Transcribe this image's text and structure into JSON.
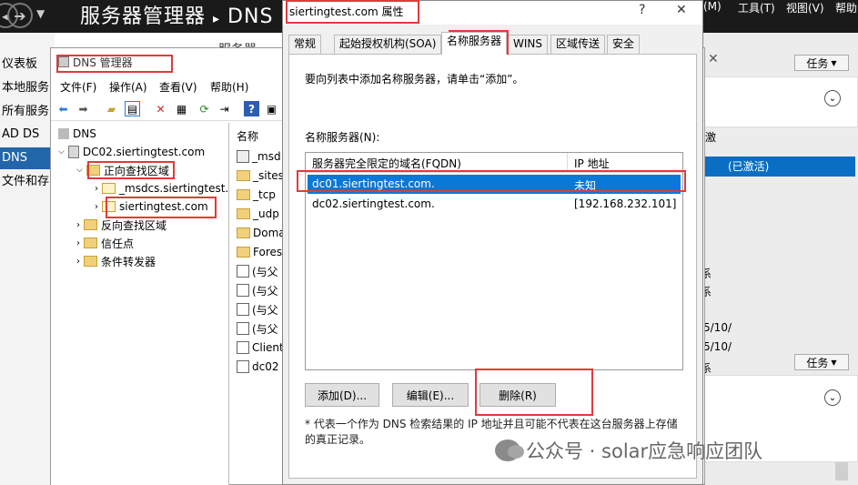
{
  "server_manager": {
    "title": "服务器管理器",
    "title_sep": "▸",
    "title_crumb": "DNS",
    "menus": [
      "(M)",
      "工具(T)",
      "视图(V)",
      "帮助"
    ],
    "sidebar": [
      "仪表板",
      "本地服务",
      "所有服务",
      "AD DS",
      "DNS",
      "文件和存"
    ],
    "sidebar_active_index": 4,
    "servers_label": "服务器",
    "tasks_label": "任务",
    "col_label": "激",
    "highlight_text": "(已激活)",
    "right_fragments": [
      "系",
      "系",
      "5/10/",
      "5/10/",
      "系"
    ]
  },
  "dns_manager": {
    "title": "DNS 管理器",
    "menu": [
      "文件(F)",
      "操作(A)",
      "查看(V)",
      "帮助(H)"
    ],
    "tree": {
      "root": "DNS",
      "server": "DC02.siertingtest.com",
      "forward_zones": "正向查找区域",
      "msdcs_zone": "_msdcs.siertingtest.",
      "zone": "siertingtest.com",
      "reverse_zones": "反向查找区域",
      "trust_points": "信任点",
      "forwarders": "条件转发器"
    },
    "list_header": "名称",
    "list_items": [
      "_msd",
      "_sites",
      "_tcp",
      "_udp",
      "Doma",
      "Fores",
      "(与父",
      "(与父",
      "(与父",
      "(与父",
      "Client",
      "dc02"
    ]
  },
  "dialog": {
    "title": "siertingtest.com 属性",
    "help_glyph": "?",
    "close_glyph": "✕",
    "tabs": [
      "常规",
      "起始授权机构(SOA)",
      "名称服务器",
      "WINS",
      "区域传送",
      "安全"
    ],
    "selected_tab_index": 2,
    "instruction": "要向列表中添加名称服务器，请单击“添加”。",
    "ns_label": "名称服务器(N):",
    "columns": {
      "fqdn": "服务器完全限定的域名(FQDN)",
      "ip": "IP 地址"
    },
    "rows": [
      {
        "fqdn": "dc01.siertingtest.com.",
        "ip": "未知",
        "selected": true
      },
      {
        "fqdn": "dc02.siertingtest.com.",
        "ip": "[192.168.232.101]",
        "selected": false
      }
    ],
    "buttons": {
      "add": "添加(D)...",
      "edit": "编辑(E)...",
      "remove": "删除(R)"
    },
    "note": "* 代表一个作为 DNS 检索结果的 IP 地址并且可能不代表在这台服务器上存储的真正记录。"
  },
  "watermark": {
    "text": "公众号 · solar应急响应团队"
  }
}
